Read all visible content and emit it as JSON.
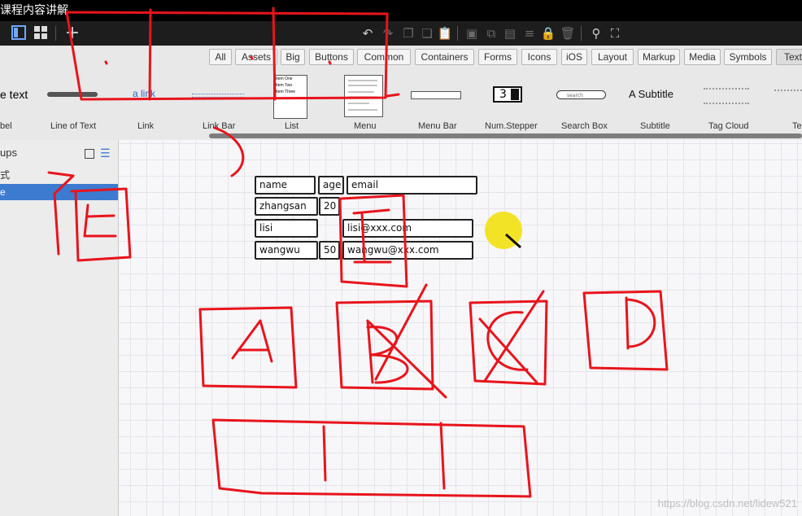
{
  "window": {
    "title": "课程内容讲解"
  },
  "toolbar": {
    "icons": [
      "panel-toggle-icon",
      "grid-view-icon",
      "add-icon",
      "undo-icon",
      "redo-icon",
      "copy-icon",
      "duplicate-icon",
      "paste-icon",
      "group-icon",
      "ungroup-icon",
      "bring-front-icon",
      "align-icon",
      "lock-icon",
      "trash-icon",
      "search-icon",
      "fullscreen-icon"
    ]
  },
  "library": {
    "tabs": [
      "All",
      "Assets",
      "Big",
      "Buttons",
      "Common",
      "Containers",
      "Forms",
      "Icons",
      "iOS",
      "Layout",
      "Markup",
      "Media",
      "Symbols",
      "Text"
    ],
    "active_tab": "Text",
    "items": [
      {
        "label": "Label",
        "preview": "e text"
      },
      {
        "label": "Line of Text",
        "preview": ""
      },
      {
        "label": "Link",
        "preview": "a link"
      },
      {
        "label": "Link Bar",
        "preview": ""
      },
      {
        "label": "List",
        "preview": [
          "Item One",
          "Item Two",
          "Item Three"
        ]
      },
      {
        "label": "Menu",
        "preview": ""
      },
      {
        "label": "Menu Bar",
        "preview": ""
      },
      {
        "label": "Num.Stepper",
        "preview": "3"
      },
      {
        "label": "Search Box",
        "preview": "search"
      },
      {
        "label": "Subtitle",
        "preview": "A Subtitle"
      },
      {
        "label": "Tag Cloud",
        "preview": ""
      },
      {
        "label": "Te",
        "preview": ""
      }
    ]
  },
  "sidebar": {
    "title": "ups",
    "rows": [
      {
        "label": "式",
        "selected": false
      },
      {
        "label": "e",
        "selected": true
      }
    ]
  },
  "canvas": {
    "table": [
      [
        "name",
        "age",
        "email"
      ],
      [
        "zhangsan",
        "20",
        ""
      ],
      [
        "lisi",
        "",
        "lisi@xxx.com"
      ],
      [
        "wangwu",
        "50",
        "wangwu@xxx.com"
      ]
    ]
  },
  "annotation": {
    "color": "#e8141c"
  },
  "watermark": "https://blog.csdn.net/lidew521"
}
